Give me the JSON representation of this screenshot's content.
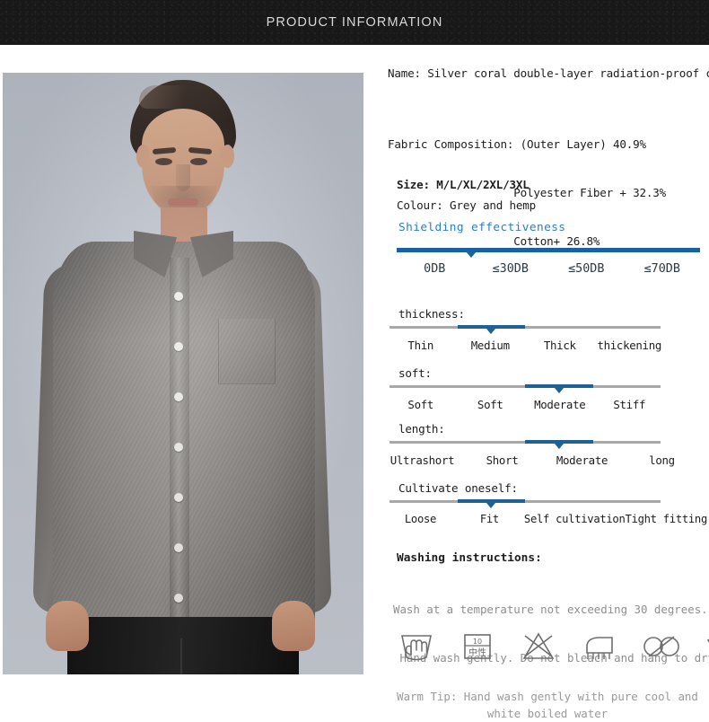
{
  "header": {
    "title": "PRODUCT INFORMATION"
  },
  "photo": {
    "alt_name": "model-wearing-grey-shirt"
  },
  "product": {
    "name_line": "Name: Silver coral double-layer radiation-proof coat",
    "fabric_label": "Fabric Composition:",
    "fabric_lines": [
      "Fabric Composition: (Outer Layer) 40.9%",
      "                   Polyester Fiber + 32.3%",
      "                   Cotton+ 26.8%"
    ],
    "size_line": "Size: M/L/XL/2XL/3XL",
    "colour_line": "Colour: Grey and hemp"
  },
  "shielding": {
    "title": "Shielding effectiveness",
    "bar_color": "#1761a4",
    "marker_index": 1,
    "labels": [
      "0DB",
      "≤30DB",
      "≤50DB",
      "≤70DB"
    ]
  },
  "scales": [
    {
      "label": "thickness:",
      "options": [
        "Thin",
        "Medium",
        "Thick",
        "thickening"
      ],
      "selected_index": 1,
      "fill_color": "#1e6195",
      "track_color": "#a8a8a8"
    },
    {
      "label": "soft:",
      "options": [
        "Soft",
        "Soft",
        "Moderate",
        "Stiff"
      ],
      "selected_index": 2,
      "fill_color": "#1e6195",
      "track_color": "#a8a8a8"
    },
    {
      "label": "length:",
      "options": [
        "Ultrashort",
        "Short",
        "Moderate",
        "long"
      ],
      "selected_index": 2,
      "fill_color": "#1e6195",
      "track_color": "#a8a8a8"
    },
    {
      "label": "Cultivate oneself:",
      "options": [
        "Loose",
        "Fit",
        "Self cultivation",
        "Tight fitting"
      ],
      "selected_index": 1,
      "fill_color": "#1e6195",
      "track_color": "#a8a8a8"
    }
  ],
  "washing": {
    "title": "Washing instructions:",
    "lines": [
      "Wash at a temperature not exceeding 30 degrees.",
      " Hand wash gently. Do not bleach and hang to dry."
    ],
    "icons": [
      {
        "name": "hand-wash-icon",
        "caption": ""
      },
      {
        "name": "neutral-detergent-icon",
        "caption_top": "10",
        "caption_bottom": "中性"
      },
      {
        "name": "no-bleach-icon",
        "caption": ""
      },
      {
        "name": "iron-icon",
        "caption": ""
      },
      {
        "name": "no-tumble-dry-icon",
        "caption": ""
      },
      {
        "name": "drip-dry-garment-icon",
        "caption": ""
      }
    ]
  },
  "warm_tip": {
    "line1": "Warm Tip: Hand wash gently with pure cool and",
    "line2": "white boiled water"
  }
}
